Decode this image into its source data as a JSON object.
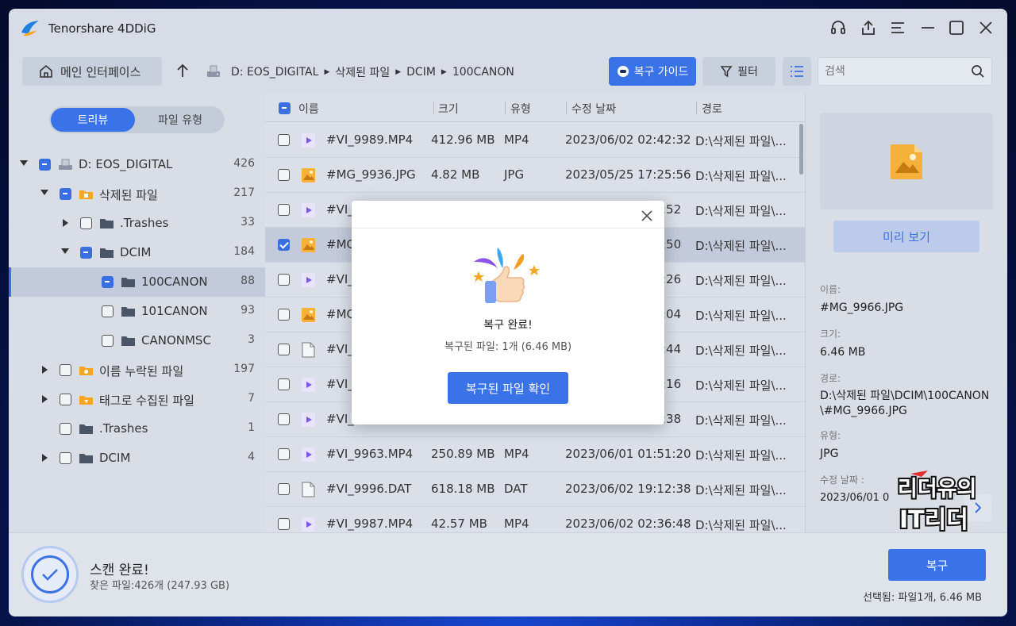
{
  "app": {
    "title": "Tenorshare 4DDiG"
  },
  "nav": {
    "home_label": "메인 인터페이스",
    "breadcrumb": [
      "D: EOS_DIGITAL",
      "삭제된 파일",
      "DCIM",
      "100CANON"
    ],
    "guide_label": "복구 가이드",
    "filter_label": "필터",
    "search_placeholder": "검색"
  },
  "sidebar": {
    "tabs": [
      "트리뷰",
      "파일 유형"
    ],
    "tree": [
      {
        "label": "D: EOS_DIGITAL",
        "count": "426"
      },
      {
        "label": "삭제된 파일",
        "count": "217"
      },
      {
        "label": ".Trashes",
        "count": "33"
      },
      {
        "label": "DCIM",
        "count": "184"
      },
      {
        "label": "100CANON",
        "count": "88"
      },
      {
        "label": "101CANON",
        "count": "93"
      },
      {
        "label": "CANONMSC",
        "count": "3"
      },
      {
        "label": "이름 누락된 파일",
        "count": "197"
      },
      {
        "label": "태그로 수집된 파일",
        "count": "7"
      },
      {
        "label": ".Trashes",
        "count": "1"
      },
      {
        "label": "DCIM",
        "count": "4"
      }
    ]
  },
  "table": {
    "headers": [
      "이름",
      "크기",
      "유형",
      "수정 날짜",
      "경로"
    ],
    "rows": [
      {
        "name": "#VI_9989.MP4",
        "size": "412.96 MB",
        "type": "MP4",
        "date": "2023/06/02 02:42:32",
        "path": "D:\\삭제된 파일\\..."
      },
      {
        "name": "#MG_9936.JPG",
        "size": "4.82 MB",
        "type": "JPG",
        "date": "2023/05/25 17:25:56",
        "path": "D:\\삭제된 파일\\..."
      },
      {
        "name": "#VI_",
        "size": "",
        "type": "",
        "date": ":52",
        "path": "D:\\삭제된 파일\\..."
      },
      {
        "name": "#MG",
        "size": "",
        "type": "",
        "date": ":50",
        "path": "D:\\삭제된 파일\\..."
      },
      {
        "name": "#VI_",
        "size": "",
        "type": "",
        "date": ":26",
        "path": "D:\\삭제된 파일\\..."
      },
      {
        "name": "#MG",
        "size": "",
        "type": "",
        "date": ":04",
        "path": "D:\\삭제된 파일\\..."
      },
      {
        "name": "#VI_",
        "size": "",
        "type": "",
        "date": ":44",
        "path": "D:\\삭제된 파일\\..."
      },
      {
        "name": "#VI_",
        "size": "",
        "type": "",
        "date": ":16",
        "path": "D:\\삭제된 파일\\..."
      },
      {
        "name": "#VI_",
        "size": "",
        "type": "",
        "date": ":38",
        "path": "D:\\삭제된 파일\\..."
      },
      {
        "name": "#VI_9963.MP4",
        "size": "250.89 MB",
        "type": "MP4",
        "date": "2023/06/01 01:51:20",
        "path": "D:\\삭제된 파일\\..."
      },
      {
        "name": "#VI_9996.DAT",
        "size": "618.18 MB",
        "type": "DAT",
        "date": "2023/06/02 19:12:38",
        "path": "D:\\삭제된 파일\\..."
      },
      {
        "name": "#VI_9987.MP4",
        "size": "42.57 MB",
        "type": "MP4",
        "date": "2023/06/02 02:36:48",
        "path": "D:\\삭제된 파일\\..."
      }
    ]
  },
  "details": {
    "preview_label": "미리 보기",
    "name_label": "이름:",
    "name_value": "#MG_9966.JPG",
    "size_label": "크기:",
    "size_value": "6.46 MB",
    "path_label": "경로:",
    "path_value": "D:\\삭제된 파일\\DCIM\\100CANON\\#MG_9966.JPG",
    "type_label": "유형:",
    "type_value": "JPG",
    "date_label": "수정 날짜 :",
    "date_value": "2023/06/01 0"
  },
  "status": {
    "title": "스캔 완료!",
    "subtitle": "찾은 파일:426개 (247.93 GB)",
    "recover_label": "복구",
    "selected_info": "선택됨: 파일1개, 6.46 MB"
  },
  "modal": {
    "title": "복구 완료!",
    "subtitle": "복구된 파일: 1개 (6.46 MB)",
    "button_label": "복구된 파일 확인"
  },
  "watermark": {
    "line1": "리더유의",
    "line2": "IT리더"
  },
  "colors": {
    "accent": "#3a72e8",
    "folder": "#f5a623",
    "video": "#7b5ce0"
  }
}
